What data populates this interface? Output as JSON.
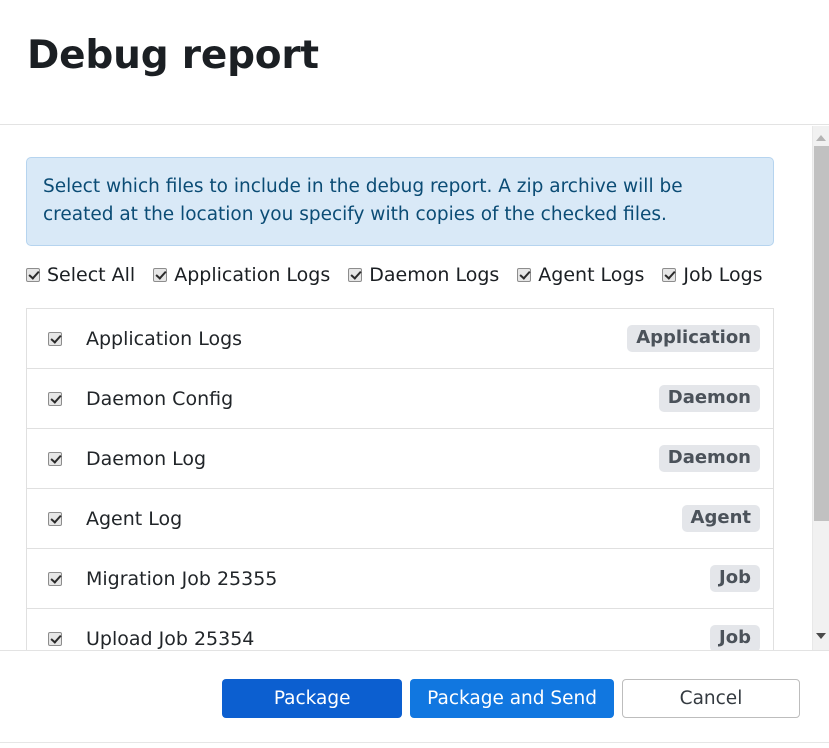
{
  "header": {
    "title": "Debug report"
  },
  "banner": {
    "text": "Select which files to include in the debug report. A zip archive will be created at the location you specify with copies of the checked files."
  },
  "filters": [
    {
      "label": "Select All",
      "checked": true
    },
    {
      "label": "Application Logs",
      "checked": true
    },
    {
      "label": "Daemon Logs",
      "checked": true
    },
    {
      "label": "Agent Logs",
      "checked": true
    },
    {
      "label": "Job Logs",
      "checked": true
    }
  ],
  "file_list": [
    {
      "name": "Application Logs",
      "badge": "Application",
      "checked": true
    },
    {
      "name": "Daemon Config",
      "badge": "Daemon",
      "checked": true
    },
    {
      "name": "Daemon Log",
      "badge": "Daemon",
      "checked": true
    },
    {
      "name": "Agent Log",
      "badge": "Agent",
      "checked": true
    },
    {
      "name": "Migration Job 25355",
      "badge": "Job",
      "checked": true
    },
    {
      "name": "Upload Job 25354",
      "badge": "Job",
      "checked": true
    }
  ],
  "scrollbar": {
    "up_arrow_icon": "triangle-up-icon",
    "down_arrow_icon": "triangle-down-icon",
    "thumb_position_percent": 0
  },
  "footer": {
    "package_label": "Package",
    "package_send_label": "Package and Send",
    "cancel_label": "Cancel"
  },
  "colors": {
    "primary": "#1177e0",
    "primary_dark": "#0c5fd0",
    "banner_bg": "#d9e9f7",
    "banner_border": "#b6d4ef",
    "banner_text": "#0b4c75",
    "badge_bg": "#e4e6ea",
    "badge_text": "#4b525a"
  }
}
